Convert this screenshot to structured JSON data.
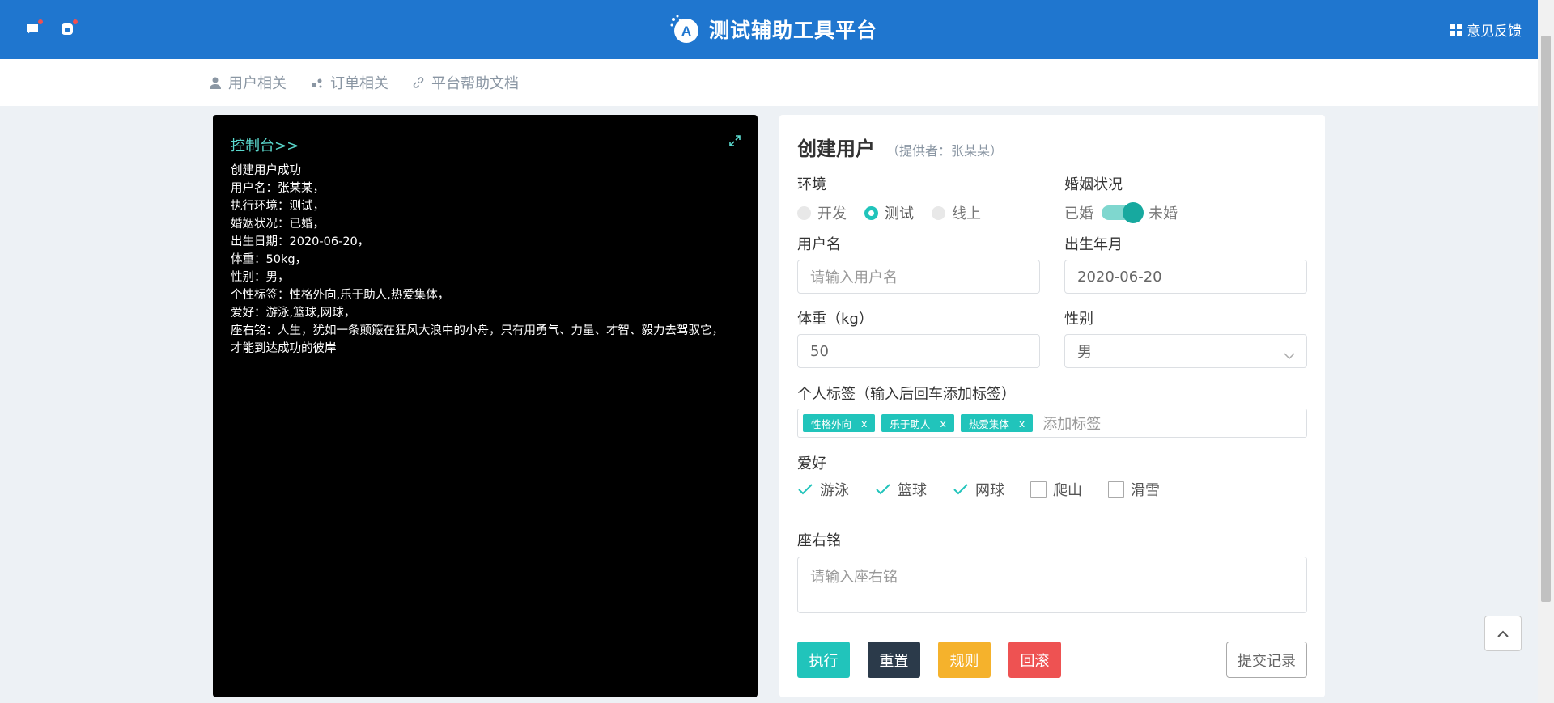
{
  "header": {
    "title": "测试辅助工具平台",
    "feedback_label": "意见反馈",
    "brand_color": "#1f76cf"
  },
  "nav": {
    "items": [
      {
        "label": "用户相关",
        "icon": "user-icon"
      },
      {
        "label": "订单相关",
        "icon": "order-icon"
      },
      {
        "label": "平台帮助文档",
        "icon": "link-icon"
      }
    ]
  },
  "console": {
    "title": "控制台>>",
    "lines": [
      "创建用户成功",
      "用户名：张某某，",
      "执行环境：测试，",
      "婚姻状况：已婚，",
      "出生日期：2020-06-20，",
      "体重：50kg，",
      "性别：男，",
      "个性标签：性格外向,乐于助人,热爱集体，",
      "爱好：游泳,篮球,网球，",
      "座右铭：人生，犹如一条颠簸在狂风大浪中的小舟，只有用勇气、力量、才智、毅力去驾驭它，",
      "才能到达成功的彼岸"
    ]
  },
  "form": {
    "title": "创建用户",
    "provider": "（提供者：张某某）",
    "env_label": "环境",
    "env_options": [
      "开发",
      "测试",
      "线上"
    ],
    "env_selected": "测试",
    "marriage_label": "婚姻状况",
    "marriage_left": "已婚",
    "marriage_right": "未婚",
    "username_label": "用户名",
    "username_placeholder": "请输入用户名",
    "birth_label": "出生年月",
    "birth_value": "2020-06-20",
    "weight_label": "体重（kg）",
    "weight_value": "50",
    "gender_label": "性别",
    "gender_value": "男",
    "tags_label": "个人标签（输入后回车添加标签）",
    "tags": [
      "性格外向",
      "乐于助人",
      "热爱集体"
    ],
    "tag_remove": "x",
    "tags_placeholder": "添加标签",
    "hobby_label": "爱好",
    "hobbies": [
      {
        "label": "游泳",
        "checked": true
      },
      {
        "label": "篮球",
        "checked": true
      },
      {
        "label": "网球",
        "checked": true
      },
      {
        "label": "爬山",
        "checked": false
      },
      {
        "label": "滑雪",
        "checked": false
      }
    ],
    "motto_label": "座右铭",
    "motto_placeholder": "请输入座右铭",
    "buttons": {
      "run": "执行",
      "reset": "重置",
      "rules": "规则",
      "rollback": "回滚",
      "history": "提交记录"
    },
    "colors": {
      "accent": "#21c4bb",
      "reset": "#2b3a4a",
      "rules": "#f5b22c",
      "rollback": "#ee5252"
    }
  }
}
